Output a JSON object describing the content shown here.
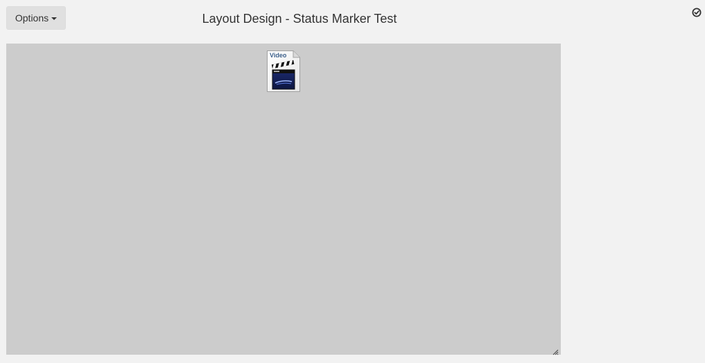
{
  "toolbar": {
    "options_label": "Options"
  },
  "header": {
    "title": "Layout Design - Status Marker Test"
  },
  "status": {
    "icon": "check-circle-icon"
  },
  "canvas": {
    "background": "#cccccc",
    "media_item": {
      "label": "Video",
      "icon": "clapperboard-icon"
    }
  }
}
